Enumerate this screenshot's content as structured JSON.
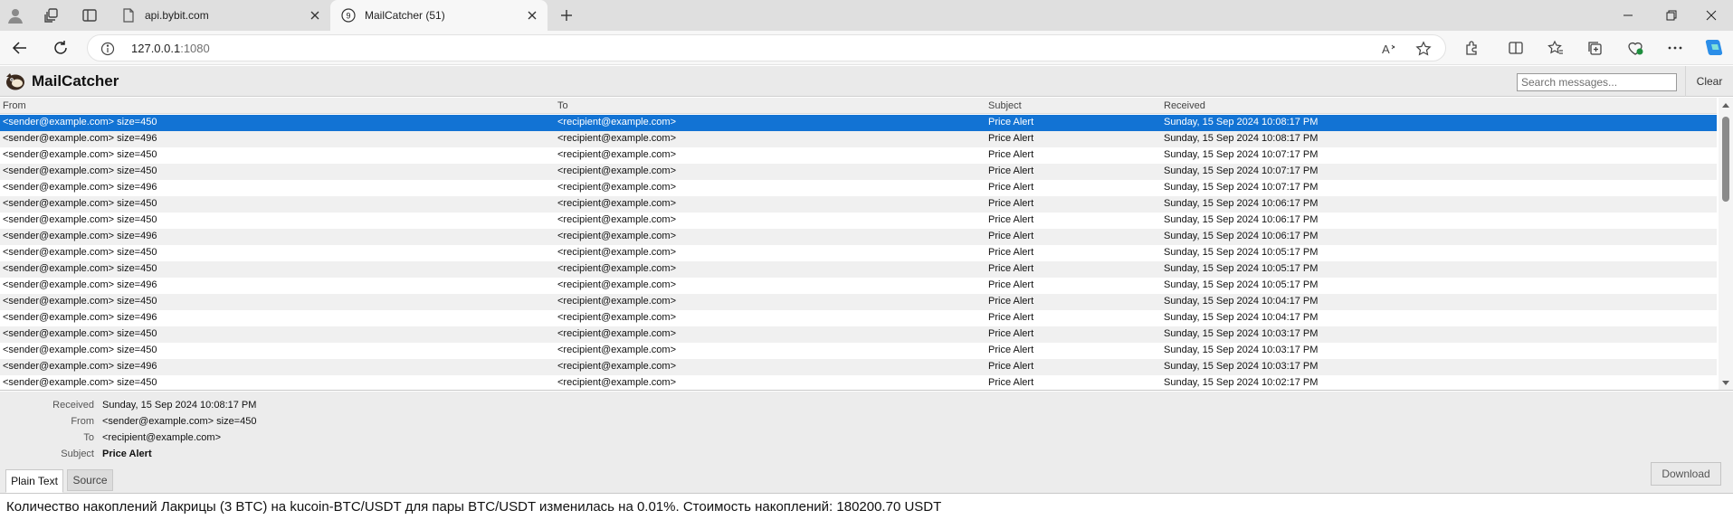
{
  "browser": {
    "tabs": [
      {
        "title": "api.bybit.com",
        "active": false,
        "favicon": "page-icon"
      },
      {
        "title": "MailCatcher (51)",
        "active": true,
        "favicon": "mailcatcher-favicon"
      }
    ],
    "url_host": "127.0.0.1",
    "url_port": ":1080"
  },
  "app": {
    "title": "MailCatcher",
    "search_placeholder": "Search messages...",
    "clear_label": "Clear"
  },
  "list": {
    "columns": [
      "From",
      "To",
      "Subject",
      "Received"
    ],
    "rows": [
      {
        "from": "<sender@example.com> size=450",
        "to": "<recipient@example.com>",
        "subject": "Price Alert",
        "received": "Sunday, 15 Sep 2024 10:08:17 PM"
      },
      {
        "from": "<sender@example.com> size=496",
        "to": "<recipient@example.com>",
        "subject": "Price Alert",
        "received": "Sunday, 15 Sep 2024 10:08:17 PM"
      },
      {
        "from": "<sender@example.com> size=450",
        "to": "<recipient@example.com>",
        "subject": "Price Alert",
        "received": "Sunday, 15 Sep 2024 10:07:17 PM"
      },
      {
        "from": "<sender@example.com> size=450",
        "to": "<recipient@example.com>",
        "subject": "Price Alert",
        "received": "Sunday, 15 Sep 2024 10:07:17 PM"
      },
      {
        "from": "<sender@example.com> size=496",
        "to": "<recipient@example.com>",
        "subject": "Price Alert",
        "received": "Sunday, 15 Sep 2024 10:07:17 PM"
      },
      {
        "from": "<sender@example.com> size=450",
        "to": "<recipient@example.com>",
        "subject": "Price Alert",
        "received": "Sunday, 15 Sep 2024 10:06:17 PM"
      },
      {
        "from": "<sender@example.com> size=450",
        "to": "<recipient@example.com>",
        "subject": "Price Alert",
        "received": "Sunday, 15 Sep 2024 10:06:17 PM"
      },
      {
        "from": "<sender@example.com> size=496",
        "to": "<recipient@example.com>",
        "subject": "Price Alert",
        "received": "Sunday, 15 Sep 2024 10:06:17 PM"
      },
      {
        "from": "<sender@example.com> size=450",
        "to": "<recipient@example.com>",
        "subject": "Price Alert",
        "received": "Sunday, 15 Sep 2024 10:05:17 PM"
      },
      {
        "from": "<sender@example.com> size=450",
        "to": "<recipient@example.com>",
        "subject": "Price Alert",
        "received": "Sunday, 15 Sep 2024 10:05:17 PM"
      },
      {
        "from": "<sender@example.com> size=496",
        "to": "<recipient@example.com>",
        "subject": "Price Alert",
        "received": "Sunday, 15 Sep 2024 10:05:17 PM"
      },
      {
        "from": "<sender@example.com> size=450",
        "to": "<recipient@example.com>",
        "subject": "Price Alert",
        "received": "Sunday, 15 Sep 2024 10:04:17 PM"
      },
      {
        "from": "<sender@example.com> size=496",
        "to": "<recipient@example.com>",
        "subject": "Price Alert",
        "received": "Sunday, 15 Sep 2024 10:04:17 PM"
      },
      {
        "from": "<sender@example.com> size=450",
        "to": "<recipient@example.com>",
        "subject": "Price Alert",
        "received": "Sunday, 15 Sep 2024 10:03:17 PM"
      },
      {
        "from": "<sender@example.com> size=450",
        "to": "<recipient@example.com>",
        "subject": "Price Alert",
        "received": "Sunday, 15 Sep 2024 10:03:17 PM"
      },
      {
        "from": "<sender@example.com> size=496",
        "to": "<recipient@example.com>",
        "subject": "Price Alert",
        "received": "Sunday, 15 Sep 2024 10:03:17 PM"
      },
      {
        "from": "<sender@example.com> size=450",
        "to": "<recipient@example.com>",
        "subject": "Price Alert",
        "received": "Sunday, 15 Sep 2024 10:02:17 PM"
      }
    ]
  },
  "message": {
    "labels": {
      "received": "Received",
      "from": "From",
      "to": "To",
      "subject": "Subject"
    },
    "received": "Sunday, 15 Sep 2024 10:08:17 PM",
    "from": "<sender@example.com> size=450",
    "to": "<recipient@example.com>",
    "subject": "Price Alert",
    "formats": [
      "Plain Text",
      "Source"
    ],
    "download_label": "Download",
    "body": "Количество накоплений Лакрицы (3 BTC) на kucoin-BTC/USDT для пары BTC/USDT изменилась на 0.01%. Стоимость накоплений: 180200.70 USDT"
  },
  "colors": {
    "selection": "#1273d4",
    "alt_row": "#f0f0f0",
    "header_bg": "#eaeaea"
  }
}
